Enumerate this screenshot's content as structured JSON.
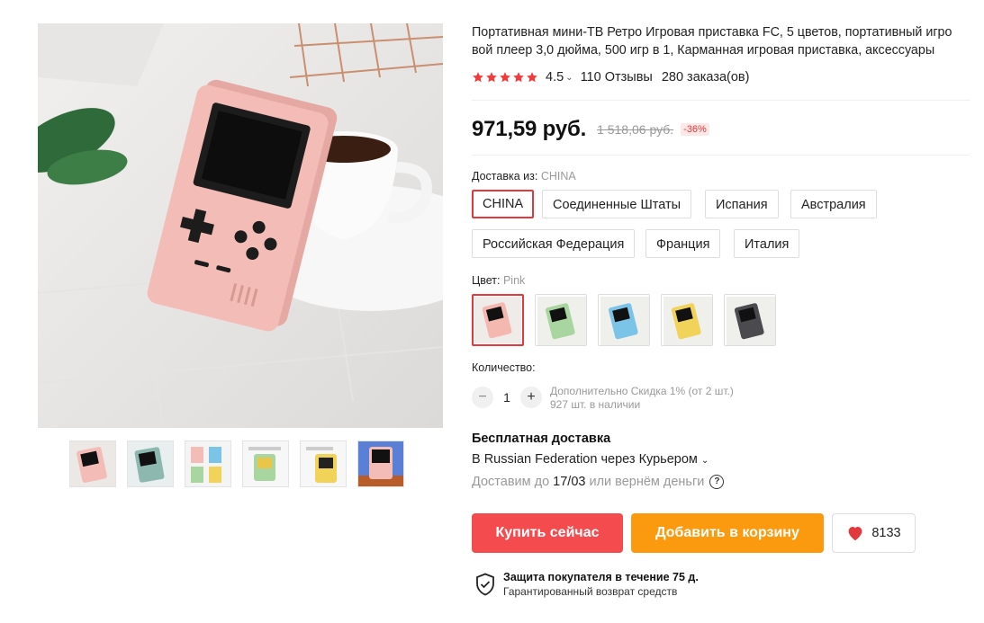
{
  "product": {
    "title": "Портативная мини-ТВ Ретро Игровая приставка FC, 5 цветов, портативный игровой плеер 3,0 дюйма, 500 игр в 1, Карманная игровая приставка, аксессуары",
    "title_line1": "Портативная мини-ТВ Ретро Игровая приставка FC, 5 цветов, портативный игро",
    "title_line2": "вой плеер 3,0 дюйма, 500 игр в 1, Карманная игровая приставка, аксессуары",
    "rating": "4.5",
    "rating_value": 4.5,
    "reviews": "110 Отзывы",
    "orders": "280 заказа(ов)",
    "price": "971,59 руб.",
    "old_price": "1 518,06 руб.",
    "discount": "-36%"
  },
  "shipping_from": {
    "label": "Доставка из:",
    "selected": "CHINA",
    "options": [
      "CHINA",
      "Соединенные Штаты",
      "Испания",
      "Австралия",
      "Российская Федерация",
      "Франция",
      "Италия"
    ]
  },
  "color": {
    "label": "Цвет:",
    "selected": "Pink",
    "options": [
      "Pink",
      "Green",
      "Blue",
      "Yellow",
      "Black"
    ],
    "swatch_colors": [
      "#f4b8b0",
      "#a9d6a0",
      "#7cc3e8",
      "#f2d35a",
      "#4a4a4f"
    ]
  },
  "quantity": {
    "label": "Количество:",
    "value": "1",
    "minus": "−",
    "plus": "+",
    "note_line1": "Дополнительно Скидка 1% (от 2 шт.)",
    "note_line2": "927 шт. в наличии"
  },
  "delivery": {
    "free_title": "Бесплатная доставка",
    "via": "В Russian Federation через Курьером",
    "prefix": "Доставим до",
    "date": "17/03",
    "suffix": "или вернём деньги",
    "help_icon": "?"
  },
  "actions": {
    "buy_now": "Купить сейчас",
    "add_to_cart": "Добавить в корзину",
    "wishlist_count": "8133"
  },
  "protection": {
    "title": "Защита покупателя в течение 75 д.",
    "subtitle": "Гарантированный возврат средств"
  },
  "icons": {
    "star": "star-icon",
    "heart": "heart-icon",
    "shield": "shield-check-icon",
    "chevron": "chevron-down-icon"
  },
  "colors": {
    "accent_red": "#f44b4e",
    "accent_orange": "#fb9a0e",
    "star_red": "#f23b3b",
    "selected_border": "#e4393c"
  }
}
